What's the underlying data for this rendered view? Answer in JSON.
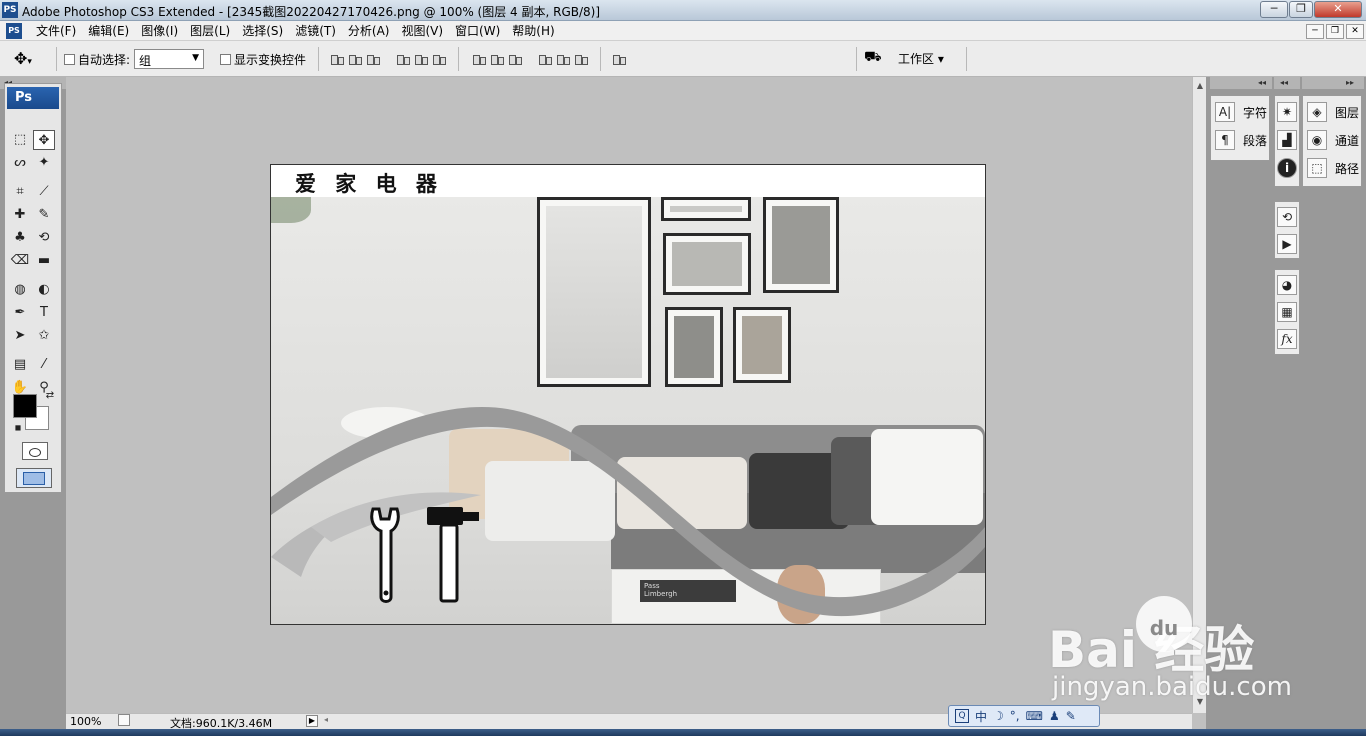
{
  "window": {
    "app_icon": "PS",
    "title": "Adobe Photoshop CS3 Extended - [2345截图20220427170426.png @ 100% (图层 4 副本, RGB/8)]",
    "controls": [
      "─",
      "❐",
      "✕"
    ]
  },
  "menubar": {
    "items": [
      "文件(F)",
      "编辑(E)",
      "图像(I)",
      "图层(L)",
      "选择(S)",
      "滤镜(T)",
      "分析(A)",
      "视图(V)",
      "窗口(W)",
      "帮助(H)"
    ],
    "mdi_controls": [
      "─",
      "❐",
      "✕"
    ]
  },
  "options": {
    "auto_select_label": "自动选择:",
    "auto_select_value": "组",
    "show_transform_label": "显示变换控件",
    "workspace_label": "工作区 ▾"
  },
  "toolbox": {
    "header": "Ps",
    "tools": [
      {
        "name": "marquee-tool",
        "glyph": "⬚"
      },
      {
        "name": "move-tool",
        "glyph": "✥"
      },
      {
        "name": "lasso-tool",
        "glyph": "ᔕ"
      },
      {
        "name": "magic-wand-tool",
        "glyph": "✦"
      },
      {
        "name": "crop-tool",
        "glyph": "⌗"
      },
      {
        "name": "slice-tool",
        "glyph": "⟋"
      },
      {
        "name": "healing-brush-tool",
        "glyph": "✚"
      },
      {
        "name": "brush-tool",
        "glyph": "✎"
      },
      {
        "name": "stamp-tool",
        "glyph": "♣"
      },
      {
        "name": "history-brush-tool",
        "glyph": "⟲"
      },
      {
        "name": "eraser-tool",
        "glyph": "⌫"
      },
      {
        "name": "gradient-tool",
        "glyph": "▬"
      },
      {
        "name": "blur-tool",
        "glyph": "◍"
      },
      {
        "name": "dodge-tool",
        "glyph": "◐"
      },
      {
        "name": "pen-tool",
        "glyph": "✒"
      },
      {
        "name": "type-tool",
        "glyph": "T"
      },
      {
        "name": "path-select-tool",
        "glyph": "➤"
      },
      {
        "name": "shape-tool",
        "glyph": "✩"
      },
      {
        "name": "notes-tool",
        "glyph": "▤"
      },
      {
        "name": "eyedropper-tool",
        "glyph": "⁄"
      },
      {
        "name": "hand-tool",
        "glyph": "✋"
      },
      {
        "name": "zoom-tool",
        "glyph": "⚲"
      }
    ],
    "colors": {
      "foreground": "#000000",
      "background": "#ffffff"
    }
  },
  "document": {
    "brand_text": "爱 家 电 器",
    "photo_text": [
      "Pass",
      "Limbergh"
    ]
  },
  "panels": {
    "group1": [
      {
        "icon": "A|",
        "label": "字符"
      },
      {
        "icon": "¶",
        "label": "段落"
      }
    ],
    "group2_icons": [
      "navigator-icon",
      "histogram-icon",
      "info-icon"
    ],
    "group3": [
      {
        "icon": "◈",
        "label": "图层"
      },
      {
        "icon": "◉",
        "label": "通道"
      },
      {
        "icon": "⬚",
        "label": "路径"
      }
    ],
    "group4_icons": [
      "history-icon",
      "actions-icon"
    ],
    "group5_icons": [
      "color-icon",
      "swatches-icon",
      "styles-icon"
    ]
  },
  "status": {
    "zoom": "100%",
    "doc_size": "文档:960.1K/3.46M"
  },
  "ime": {
    "items": [
      "中",
      "☽",
      "°,",
      "⌨",
      "♟",
      "✎"
    ]
  },
  "watermark": {
    "main": "Bai 经验",
    "paw": "du",
    "sub": "jingyan.baidu.com"
  }
}
